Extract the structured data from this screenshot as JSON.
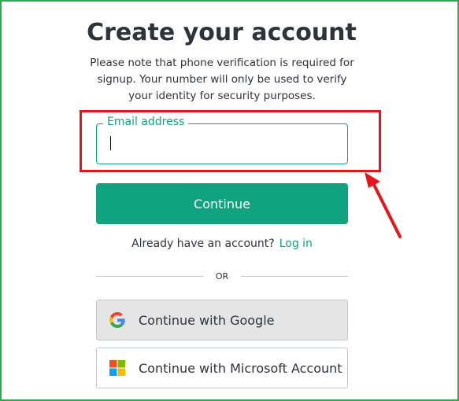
{
  "page": {
    "title": "Create your account",
    "subtitle": "Please note that phone verification is required for signup. Your number will only be used to verify your identity for security purposes."
  },
  "form": {
    "email_label": "Email address",
    "email_value": "",
    "continue_label": "Continue"
  },
  "login": {
    "prompt": "Already have an account?",
    "link": "Log in"
  },
  "divider": {
    "text": "OR"
  },
  "social": {
    "google_label": "Continue with Google",
    "google_icon": "google-icon",
    "microsoft_label": "Continue with Microsoft Account",
    "microsoft_icon": "microsoft-icon"
  },
  "colors": {
    "accent": "#10a37f",
    "highlight": "#e8141c",
    "frame": "#2fa84f"
  }
}
